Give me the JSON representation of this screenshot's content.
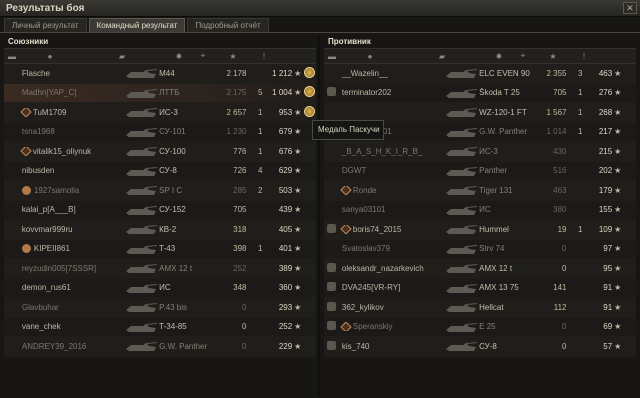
{
  "window": {
    "title": "Результаты боя",
    "close": "✕"
  },
  "tabs": [
    {
      "label": "Личный результат",
      "active": false
    },
    {
      "label": "Командный результат",
      "active": true
    },
    {
      "label": "Подробный отчёт",
      "active": false
    }
  ],
  "allies": {
    "title": "Союзники",
    "rows": [
      {
        "name": "Flasche",
        "tank": "M44",
        "damage": "2 178",
        "frags": "",
        "xp": "1 212",
        "medal": true,
        "dim": false,
        "icon": ""
      },
      {
        "name": "Madhn[YAP_C]",
        "tank": "ЛТТБ",
        "damage": "2 175",
        "frags": "5",
        "xp": "1 004",
        "medal": true,
        "dim": true,
        "icon": "",
        "highlight": true
      },
      {
        "name": "TuM1709",
        "tank": "ИС-3",
        "damage": "2 657",
        "frags": "1",
        "xp": "953",
        "medal": true,
        "dim": false,
        "icon": "rhomb"
      },
      {
        "name": "tsna1968",
        "tank": "СУ-101",
        "damage": "1 230",
        "frags": "1",
        "xp": "679",
        "medal": false,
        "dim": true,
        "icon": ""
      },
      {
        "name": "vitalik15_oliynuk",
        "tank": "СУ-100",
        "damage": "776",
        "frags": "1",
        "xp": "676",
        "medal": false,
        "dim": false,
        "icon": "rhomb"
      },
      {
        "name": "nibusden",
        "tank": "СУ-8",
        "damage": "726",
        "frags": "4",
        "xp": "629",
        "medal": false,
        "dim": false,
        "icon": ""
      },
      {
        "name": "1927samolia",
        "tank": "SP I C",
        "damage": "285",
        "frags": "2",
        "xp": "503",
        "medal": false,
        "dim": true,
        "icon": "clan"
      },
      {
        "name": "kalai_p[A___B]",
        "tank": "СУ-152",
        "damage": "705",
        "frags": "",
        "xp": "439",
        "medal": false,
        "dim": false,
        "icon": ""
      },
      {
        "name": "kovvmar999ru",
        "tank": "КВ-2",
        "damage": "318",
        "frags": "",
        "xp": "405",
        "medal": false,
        "dim": false,
        "icon": ""
      },
      {
        "name": "KIPEII861",
        "tank": "T-43",
        "damage": "398",
        "frags": "1",
        "xp": "401",
        "medal": false,
        "dim": false,
        "icon": "clan"
      },
      {
        "name": "reyzudin005[7SSSR]",
        "tank": "AMX 12 t",
        "damage": "252",
        "frags": "",
        "xp": "389",
        "medal": false,
        "dim": true,
        "icon": ""
      },
      {
        "name": "demon_rus61",
        "tank": "ИС",
        "damage": "348",
        "frags": "",
        "xp": "360",
        "medal": false,
        "dim": false,
        "icon": ""
      },
      {
        "name": "Glavbuhar",
        "tank": "P.43 bis",
        "damage": "0",
        "frags": "",
        "xp": "293",
        "medal": false,
        "dim": true,
        "icon": ""
      },
      {
        "name": "vane_chek",
        "tank": "T-34-85",
        "damage": "0",
        "frags": "",
        "xp": "252",
        "medal": false,
        "dim": false,
        "icon": ""
      },
      {
        "name": "ANDREY39_2016",
        "tank": "G.W. Panther",
        "damage": "0",
        "frags": "",
        "xp": "229",
        "medal": false,
        "dim": true,
        "icon": ""
      }
    ]
  },
  "enemies": {
    "title": "Противник",
    "rows": [
      {
        "name": "__Wazelin__",
        "tank": "ELC EVEN 90",
        "damage": "2 355",
        "frags": "3",
        "xp": "463",
        "dim": false,
        "icon": ""
      },
      {
        "name": "terminator202",
        "tank": "Škoda T 25",
        "damage": "705",
        "frags": "1",
        "xp": "276",
        "dim": false,
        "icon": "skull"
      },
      {
        "name": "",
        "tank": "WZ-120-1 FT",
        "damage": "1 567",
        "frags": "1",
        "xp": "268",
        "dim": false,
        "icon": ""
      },
      {
        "name": "kz_astana_01",
        "tank": "G.W. Panther",
        "damage": "1 014",
        "frags": "1",
        "xp": "217",
        "dim": true,
        "icon": ""
      },
      {
        "name": "_B_A_S_H_K_I_R_B_",
        "tank": "ИС-3",
        "damage": "430",
        "frags": "",
        "xp": "215",
        "dim": true,
        "icon": ""
      },
      {
        "name": "DGWT",
        "tank": "Panther",
        "damage": "516",
        "frags": "",
        "xp": "202",
        "dim": true,
        "icon": ""
      },
      {
        "name": "Ronde",
        "tank": "Tiger 131",
        "damage": "463",
        "frags": "",
        "xp": "179",
        "dim": true,
        "icon": "rhomb"
      },
      {
        "name": "sanya03101",
        "tank": "ИС",
        "damage": "380",
        "frags": "",
        "xp": "155",
        "dim": true,
        "icon": ""
      },
      {
        "name": "boris74_2015",
        "tank": "Hummel",
        "damage": "19",
        "frags": "1",
        "xp": "109",
        "dim": false,
        "icon": "skullrhomb"
      },
      {
        "name": "Svatoslav379",
        "tank": "Strv 74",
        "damage": "0",
        "frags": "",
        "xp": "97",
        "dim": true,
        "icon": ""
      },
      {
        "name": "oleksandr_nazarkevich",
        "tank": "AMX 12 t",
        "damage": "0",
        "frags": "",
        "xp": "95",
        "dim": false,
        "icon": "skull"
      },
      {
        "name": "DVA245[VR-RY]",
        "tank": "AMX 13 75",
        "damage": "141",
        "frags": "",
        "xp": "91",
        "dim": false,
        "icon": "skull"
      },
      {
        "name": "362_kylikov",
        "tank": "Hellcat",
        "damage": "112",
        "frags": "",
        "xp": "91",
        "dim": false,
        "icon": "skull"
      },
      {
        "name": "Speranskiy",
        "tank": "E 25",
        "damage": "0",
        "frags": "",
        "xp": "69",
        "dim": true,
        "icon": "skullrhomb"
      },
      {
        "name": "kis_740",
        "tank": "СУ-8",
        "damage": "0",
        "frags": "",
        "xp": "57",
        "dim": false,
        "icon": "skull"
      }
    ]
  },
  "tooltip": "Медаль Паскучи",
  "colors": {
    "accent": "#e0b75a",
    "highlight_row": "#3a2a22"
  }
}
